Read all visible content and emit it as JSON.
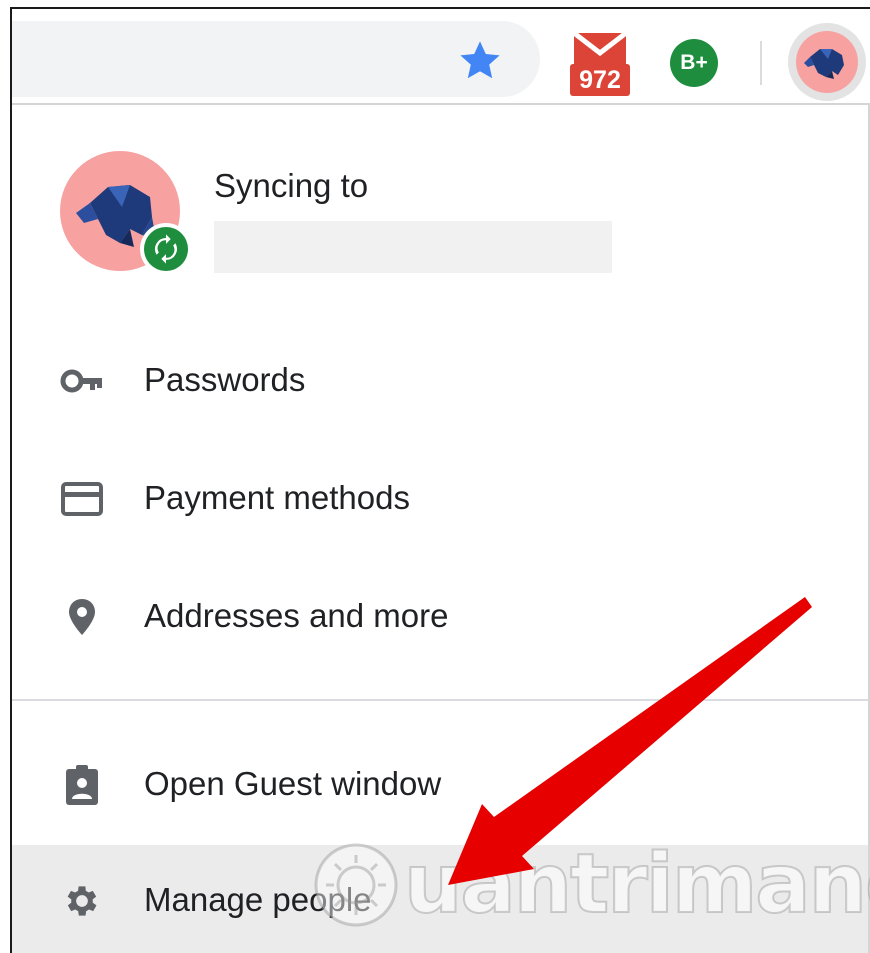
{
  "toolbar": {
    "star_icon": "bookmark-star-icon",
    "gmail_icon": "gmail-envelope-icon",
    "gmail_count": "972",
    "extension_label": "B+",
    "profile_icon": "profile-avatar-icon"
  },
  "profile": {
    "syncing_label": "Syncing to",
    "sync_badge_icon": "sync-icon"
  },
  "menu": {
    "items": [
      {
        "label": "Passwords",
        "icon": "key-icon"
      },
      {
        "label": "Payment methods",
        "icon": "credit-card-icon"
      },
      {
        "label": "Addresses and more",
        "icon": "location-pin-icon"
      },
      {
        "label": "Open Guest window",
        "icon": "guest-badge-icon"
      },
      {
        "label": "Manage people",
        "icon": "gear-icon"
      }
    ]
  },
  "watermark": {
    "text": "uantrimang"
  },
  "colors": {
    "star_blue": "#4285f4",
    "gmail_red": "#db4437",
    "extension_green": "#1e8e3e",
    "avatar_pink": "#f7a1a1",
    "arrow_red": "#e60000",
    "hover_gray": "#ebebeb"
  }
}
